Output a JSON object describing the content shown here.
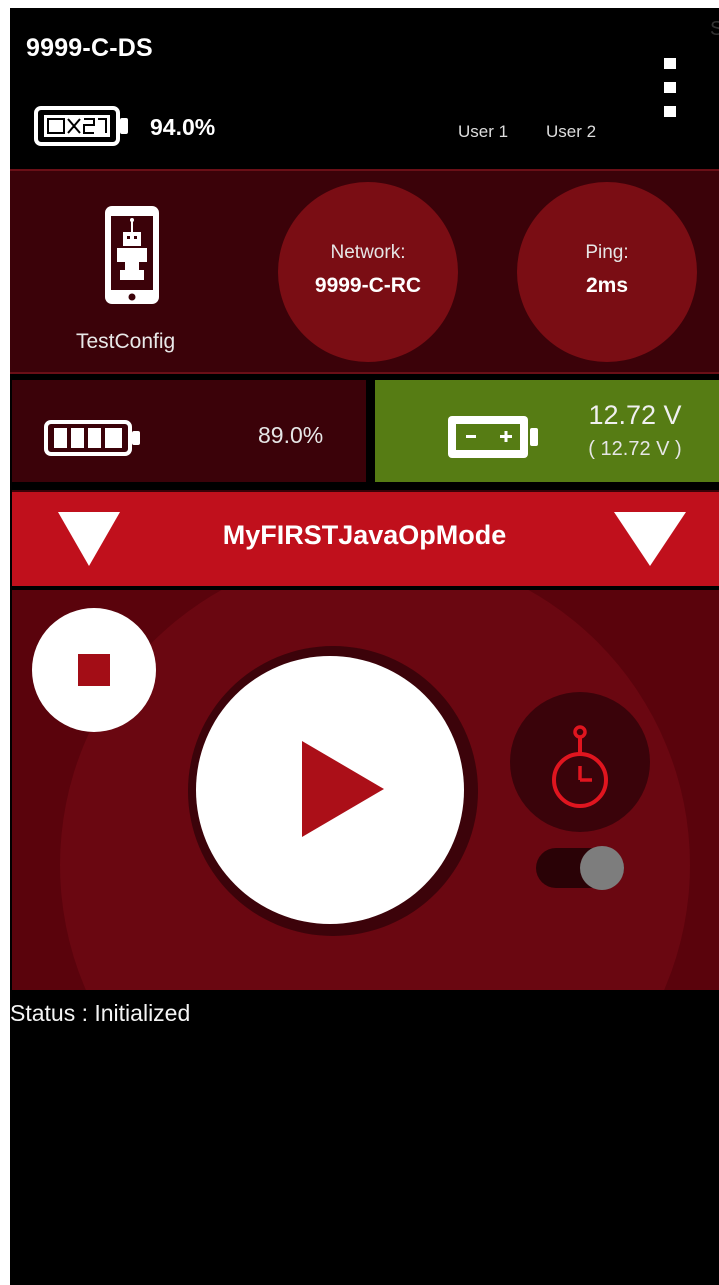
{
  "header": {
    "device_name": "9999-C-DS",
    "ds_battery_percent": "94.0%",
    "users": [
      "User 1",
      "User 2"
    ],
    "menu_icon": "overflow-menu-icon"
  },
  "status_panel": {
    "config_icon": "robot-phone-icon",
    "config_name": "TestConfig",
    "network_label": "Network:",
    "network_value": "9999-C-RC",
    "ping_label": "Ping:",
    "ping_value": "2ms"
  },
  "batteries": {
    "rc_battery_icon": "battery-icon",
    "rc_battery_percent": "89.0%",
    "robot_battery_icon": "robot-battery-icon",
    "robot_voltage": "12.72 V",
    "robot_voltage_min": "( 12.72 V )",
    "robot_battery_color": "#567c14"
  },
  "opmode": {
    "name": "MyFIRSTJavaOpMode",
    "bar_color": "#c0101c"
  },
  "controls": {
    "stop_icon": "stop-icon",
    "play_icon": "play-icon",
    "timer_icon": "stopwatch-icon",
    "timer_toggle_on": false
  },
  "status": {
    "text": "Status : Initialized"
  }
}
